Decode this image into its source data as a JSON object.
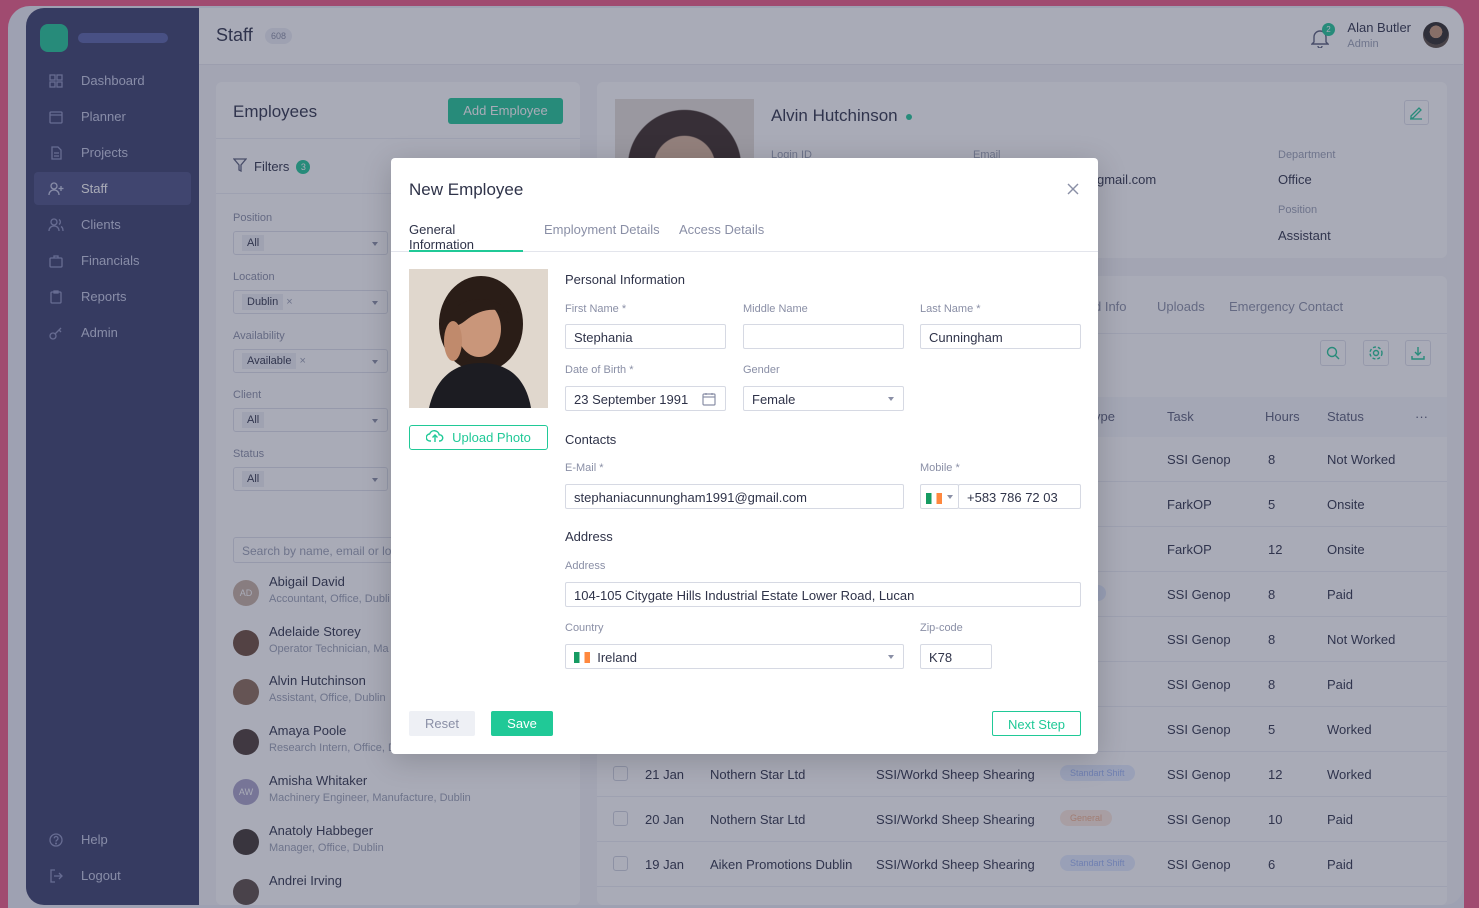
{
  "topbar": {
    "title": "Staff",
    "count": "608",
    "notifications": "2",
    "user_name": "Alan Butler",
    "user_role": "Admin"
  },
  "sidebar": {
    "items": [
      {
        "label": "Dashboard",
        "icon": "grid-icon"
      },
      {
        "label": "Planner",
        "icon": "calendar-icon"
      },
      {
        "label": "Projects",
        "icon": "document-icon"
      },
      {
        "label": "Staff",
        "icon": "user-plus-icon",
        "active": true
      },
      {
        "label": "Clients",
        "icon": "users-icon"
      },
      {
        "label": "Financials",
        "icon": "briefcase-icon"
      },
      {
        "label": "Reports",
        "icon": "clipboard-icon"
      },
      {
        "label": "Admin",
        "icon": "key-icon"
      }
    ],
    "bottom": [
      {
        "label": "Help",
        "icon": "help-icon"
      },
      {
        "label": "Logout",
        "icon": "logout-icon"
      }
    ]
  },
  "employees_panel": {
    "title": "Employees",
    "add_button": "Add Employee",
    "filters_label": "Filters",
    "filters_count": "3",
    "filters": [
      {
        "label": "Position",
        "value": "All"
      },
      {
        "label": "Location",
        "value": "Dublin"
      },
      {
        "label": "Availability",
        "value": "Available"
      },
      {
        "label": "Client",
        "value": "All"
      },
      {
        "label": "Status",
        "value": "All"
      }
    ],
    "search_placeholder": "Search by name, email or lo",
    "list": [
      {
        "name": "Abigail David",
        "sub": "Accountant, Office, Dubli",
        "initials": "AD"
      },
      {
        "name": "Adelaide Storey",
        "sub": "Operator Technician, Ma",
        "initials": ""
      },
      {
        "name": "Alvin Hutchinson",
        "sub": "Assistant, Office, Dublin",
        "initials": ""
      },
      {
        "name": "Amaya Poole",
        "sub": "Research Intern, Office, D",
        "initials": ""
      },
      {
        "name": "Amisha Whitaker",
        "sub": "Machinery Engineer, Manufacture, Dublin",
        "initials": "AW"
      },
      {
        "name": "Anatoly Habbeger",
        "sub": "Manager, Office, Dublin",
        "initials": ""
      },
      {
        "name": "Andrei Irving",
        "sub": "",
        "initials": ""
      }
    ]
  },
  "profile": {
    "name": "Alvin Hutchinson",
    "login_label": "Login ID",
    "email_label": "Email",
    "email_value": "gmail.com",
    "department_label": "Department",
    "department_value": "Office",
    "position_label": "Position",
    "position_value": "Assistant"
  },
  "profile_tabs": [
    "d Info",
    "Uploads",
    "Emergency Contact"
  ],
  "table": {
    "headers": {
      "type": "ype",
      "task": "Task",
      "hours": "Hours",
      "status": "Status",
      "more": "···"
    },
    "rows": [
      {
        "date": "",
        "client": "",
        "project": "",
        "type": "Shift",
        "task": "SSI Genop",
        "hours": "8",
        "status": "Not Worked"
      },
      {
        "date": "",
        "client": "",
        "project": "",
        "type": "n",
        "task": "FarkOP",
        "hours": "5",
        "status": "Onsite"
      },
      {
        "date": "",
        "client": "",
        "project": "",
        "type": "n",
        "task": "FarkOP",
        "hours": "12",
        "status": "Onsite"
      },
      {
        "date": "",
        "client": "",
        "project": "",
        "type": "rt Shift",
        "task": "SSI Genop",
        "hours": "8",
        "status": "Paid"
      },
      {
        "date": "",
        "client": "",
        "project": "",
        "type": "al",
        "task": "SSI Genop",
        "hours": "8",
        "status": "Not Worked"
      },
      {
        "date": "",
        "client": "",
        "project": "",
        "type": "al",
        "task": "SSI Genop",
        "hours": "8",
        "status": "Paid"
      },
      {
        "date": "",
        "client": "",
        "project": "",
        "type": "n",
        "task": "SSI Genop",
        "hours": "5",
        "status": "Worked"
      },
      {
        "date": "21 Jan",
        "client": "Nothern Star Ltd",
        "project": "SSI/Workd Sheep Shearing",
        "type": "Standart Shift",
        "task": "SSI Genop",
        "hours": "12",
        "status": "Worked"
      },
      {
        "date": "20 Jan",
        "client": "Nothern Star Ltd",
        "project": "SSI/Workd Sheep Shearing",
        "type": "General",
        "task": "SSI Genop",
        "hours": "10",
        "status": "Paid"
      },
      {
        "date": "19 Jan",
        "client": "Aiken Promotions Dublin",
        "project": "SSI/Workd Sheep Shearing",
        "type": "Standart Shift",
        "task": "SSI Genop",
        "hours": "6",
        "status": "Paid"
      }
    ]
  },
  "modal": {
    "title": "New Employee",
    "tabs": [
      "General Information",
      "Employment Details",
      "Access Details"
    ],
    "upload_label": "Upload Photo",
    "personal_title": "Personal Information",
    "first_name_label": "First Name *",
    "first_name": "Stephania",
    "middle_name_label": "Middle Name",
    "middle_name": "",
    "last_name_label": "Last Name *",
    "last_name": "Cunningham",
    "dob_label": "Date of Birth *",
    "dob": "23 September 1991",
    "gender_label": "Gender",
    "gender": "Female",
    "contacts_title": "Contacts",
    "email_label": "E-Mail *",
    "email": "stephaniacunnungham1991@gmail.com",
    "mobile_label": "Mobile *",
    "mobile": "+583 786 72 03",
    "address_title": "Address",
    "address_label": "Address",
    "address": "104-105 Citygate Hills Industrial Estate Lower Road, Lucan",
    "country_label": "Country",
    "country": "Ireland",
    "zip_label": "Zip-code",
    "zip": "K78",
    "reset": "Reset",
    "save": "Save",
    "next": "Next Step"
  },
  "colors": {
    "accent": "#20c997",
    "sidebar": "#3a3f6b",
    "frame": "#f05a86"
  }
}
